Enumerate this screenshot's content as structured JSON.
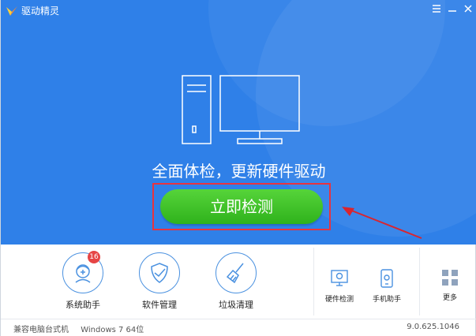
{
  "window": {
    "title": "驱动精灵",
    "controls": [
      "menu-icon",
      "minimize-icon",
      "close-icon"
    ]
  },
  "hero": {
    "slogan": "全面体检，更新硬件驱动",
    "scan_button": "立即检测",
    "background_color": "#2f80e8",
    "button_color": "#3cbf2a"
  },
  "tools": {
    "main": [
      {
        "label": "系统助手",
        "icon": "doctor-icon",
        "badge": "16"
      },
      {
        "label": "软件管理",
        "icon": "shield-icon"
      },
      {
        "label": "垃圾清理",
        "icon": "broom-icon"
      }
    ],
    "mini": [
      {
        "label": "硬件检测",
        "icon": "monitor-search-icon"
      },
      {
        "label": "手机助手",
        "icon": "phone-icon"
      },
      {
        "label": "更多",
        "icon": "grid-icon"
      }
    ]
  },
  "status": {
    "machine": "兼容电脑台式机",
    "os": "Windows 7 64位",
    "version": "9.0.625.1046"
  }
}
